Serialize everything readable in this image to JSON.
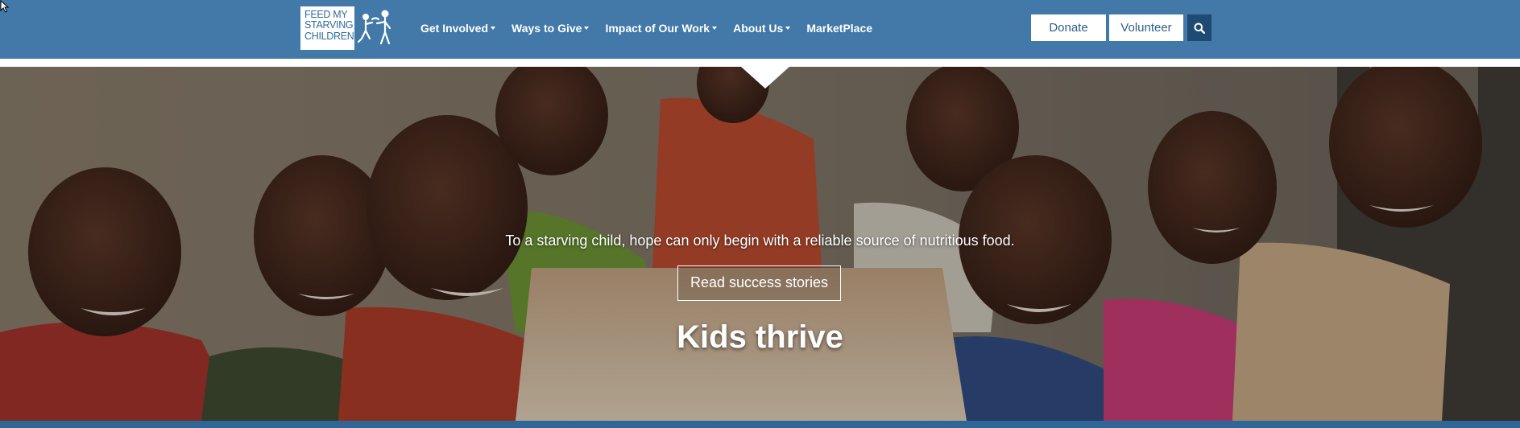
{
  "header": {
    "logo": {
      "text": "Feed my\nstarving\nchildren"
    },
    "nav": [
      {
        "label": "Get Involved",
        "dropdown": true
      },
      {
        "label": "Ways to Give",
        "dropdown": true
      },
      {
        "label": "Impact of Our Work",
        "dropdown": true
      },
      {
        "label": "About Us",
        "dropdown": true
      },
      {
        "label": "MarketPlace",
        "dropdown": false
      }
    ],
    "donate_label": "Donate",
    "volunteer_label": "Volunteer",
    "search_icon": "search-icon"
  },
  "hero": {
    "tagline": "To a starving child, hope can only begin with a reliable source of nutritious food.",
    "button_label": "Read success stories",
    "title": "Kids thrive"
  },
  "colors": {
    "header_bg": "#4279a8",
    "search_bg": "#1f4a72",
    "bottom_bar": "#2e6697"
  }
}
